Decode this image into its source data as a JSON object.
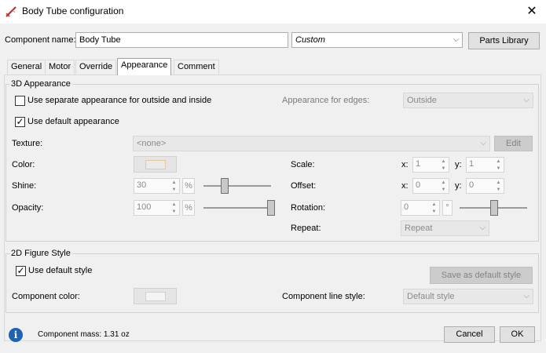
{
  "window": {
    "title": "Body Tube configuration",
    "close_glyph": "✕"
  },
  "component": {
    "name_label": "Component name:",
    "name_value": "Body Tube",
    "preset_value": "Custom",
    "parts_library_button": "Parts Library"
  },
  "tabs": [
    {
      "label": "General"
    },
    {
      "label": "Motor"
    },
    {
      "label": "Override"
    },
    {
      "label": "Appearance",
      "active": true
    },
    {
      "label": "Comment"
    }
  ],
  "appearance3d": {
    "group_label": "3D Appearance",
    "separate_outside_inside": {
      "label": "Use separate appearance for outside and inside",
      "checked": false
    },
    "edges_label": "Appearance for edges:",
    "edges_value": "Outside",
    "use_default": {
      "label": "Use default appearance",
      "checked": true
    },
    "texture_label": "Texture:",
    "texture_value": "<none>",
    "edit_button": "Edit",
    "color_label": "Color:",
    "color_swatch": "#e9d5b8",
    "shine_label": "Shine:",
    "shine_value": "30",
    "shine_unit": "%",
    "shine_level": 0.3,
    "opacity_label": "Opacity:",
    "opacity_value": "100",
    "opacity_unit": "%",
    "opacity_level": 1.0,
    "scale_label": "Scale:",
    "scale_x_label": "x:",
    "scale_x": "1",
    "scale_y_label": "y:",
    "scale_y": "1",
    "offset_label": "Offset:",
    "offset_x_label": "x:",
    "offset_x": "0",
    "offset_y_label": "y:",
    "offset_y": "0",
    "rotation_label": "Rotation:",
    "rotation_value": "0",
    "rotation_unit": "°",
    "rotation_level": 0.5,
    "repeat_label": "Repeat:",
    "repeat_value": "Repeat"
  },
  "figure2d": {
    "group_label": "2D Figure Style",
    "use_default_style": {
      "label": "Use default style",
      "checked": true
    },
    "save_default_button": "Save as default style",
    "component_color_label": "Component color:",
    "line_style_label": "Component line style:",
    "line_style_value": "Default style"
  },
  "footer": {
    "mass_text": "Component mass: 1.31 oz",
    "cancel_button": "Cancel",
    "ok_button": "OK"
  },
  "icons": {
    "app": "rocket-icon",
    "info": "info-icon",
    "check": "✓",
    "arrow_down": "⌵",
    "spin_up": "▲",
    "spin_down": "▼"
  }
}
